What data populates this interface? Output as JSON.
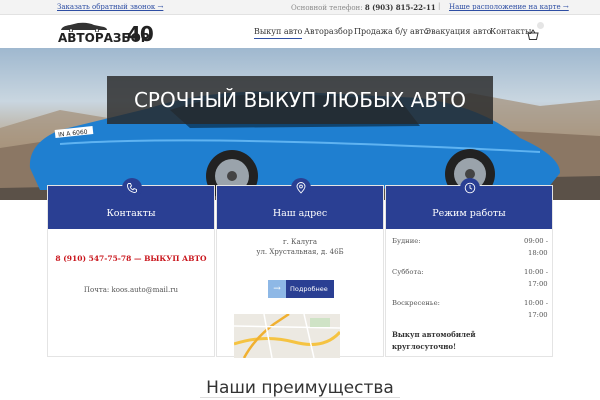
{
  "topbar": {
    "callback_link": "Заказать обратный звонок →",
    "phone_label": "Основной телефон:",
    "phone_number": "8 (903) 815-22-11",
    "separator": "|",
    "map_link": "Наше расположение на карте →"
  },
  "logo": {
    "text": "АВТОРАЗБОР",
    "number": "40"
  },
  "nav": {
    "items": [
      {
        "label": "Выкуп авто",
        "active": true
      },
      {
        "label": "Авторазбор",
        "active": false
      },
      {
        "label": "Продажа б/у авто",
        "active": false
      },
      {
        "label": "Эвакуация авто",
        "active": false
      },
      {
        "label": "Контакты",
        "active": false
      }
    ],
    "cart_icon": "cart-icon"
  },
  "hero": {
    "title": "СРОЧНЫЙ ВЫКУП ЛЮБЫХ АВТО",
    "plate": "IN A 6060"
  },
  "cards": {
    "contacts": {
      "title": "Контакты",
      "icon": "phone-icon",
      "phone_line": "8 (910) 547-75-78 — ВЫКУП АВТО",
      "email_line": "Почта: koos.auto@mail.ru"
    },
    "address": {
      "title": "Наш адрес",
      "icon": "location-pin-icon",
      "city": "г. Калуга",
      "street": "ул. Хрустальная, д. 46Б",
      "button_label": "Подробнее",
      "button_icon": "arrow-right-icon"
    },
    "hours": {
      "title": "Режим работы",
      "icon": "clock-icon",
      "rows": [
        {
          "day": "Будние:",
          "from": "09:00 -",
          "to": "18:00"
        },
        {
          "day": "Суббота:",
          "from": "10:00 -",
          "to": "17:00"
        },
        {
          "day": "Воскресенье:",
          "from": "10:00 -",
          "to": "17:00"
        }
      ],
      "note_line1": "Выкуп автомобилей",
      "note_line2": "круглосуточно!"
    }
  },
  "advantages": {
    "heading": "Наши преимущества"
  },
  "colors": {
    "accent": "#2a3f93",
    "link": "#2e4ea3",
    "alert_red": "#c9141b",
    "car_blue": "#1f7fd0"
  }
}
